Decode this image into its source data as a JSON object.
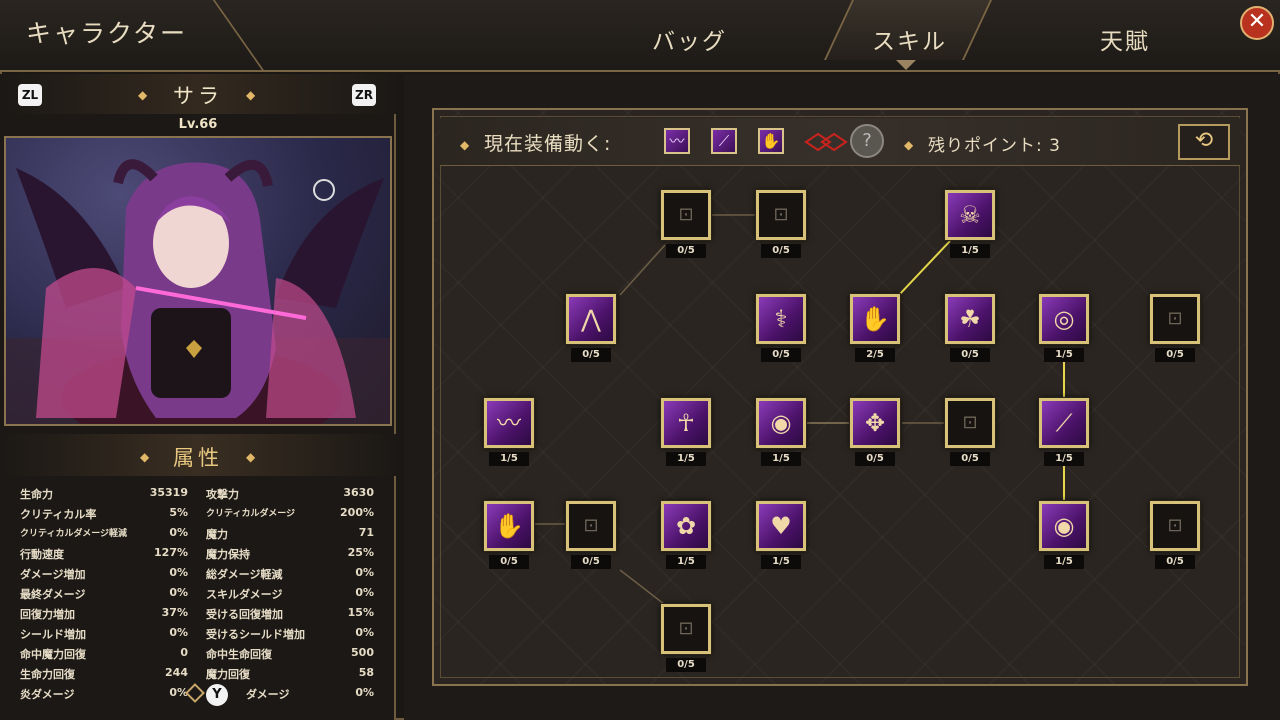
{
  "header": {
    "title": "キャラクター",
    "tabs": [
      {
        "label": "バッグ",
        "active": false
      },
      {
        "label": "スキル",
        "active": true
      },
      {
        "label": "天賦",
        "active": false
      }
    ],
    "close_icon": "close-icon"
  },
  "character": {
    "zl": "ZL",
    "zr": "ZR",
    "name": "サラ",
    "level": "Lv.66"
  },
  "attributes": {
    "title": "属性",
    "left": [
      {
        "label": "生命力",
        "value": "35319"
      },
      {
        "label": "クリティカル率",
        "value": "5%"
      },
      {
        "label": "クリティカルダメージ軽減",
        "value": "0%"
      },
      {
        "label": "行動速度",
        "value": "127%"
      },
      {
        "label": "ダメージ増加",
        "value": "0%"
      },
      {
        "label": "最終ダメージ",
        "value": "0%"
      },
      {
        "label": "回復力増加",
        "value": "37%"
      },
      {
        "label": "シールド増加",
        "value": "0%"
      },
      {
        "label": "命中魔力回復",
        "value": "0"
      },
      {
        "label": "生命力回復",
        "value": "244"
      },
      {
        "label": "炎ダメージ",
        "value": "0%"
      }
    ],
    "right": [
      {
        "label": "攻撃力",
        "value": "3630"
      },
      {
        "label": "クリティカルダメージ",
        "value": "200%"
      },
      {
        "label": "魔力",
        "value": "71"
      },
      {
        "label": "魔力保持",
        "value": "25%"
      },
      {
        "label": "総ダメージ軽減",
        "value": "0%"
      },
      {
        "label": "スキルダメージ",
        "value": "0%"
      },
      {
        "label": "受ける回復増加",
        "value": "15%"
      },
      {
        "label": "受けるシールド増加",
        "value": "0%"
      },
      {
        "label": "命中生命回復",
        "value": "500"
      },
      {
        "label": "魔力回復",
        "value": "58"
      },
      {
        "label": "ダメージ",
        "value": "0%"
      }
    ]
  },
  "skills_panel": {
    "equipped_label": "現在装備動く:",
    "remaining_label": "残りポイント: 3",
    "help": "?",
    "reset_icon": "reset-icon",
    "y_button": "Y"
  },
  "skill_nodes": [
    {
      "id": "n1",
      "icon": "lock-icon",
      "glyph": "🔒",
      "state": "locked",
      "level": "0/5"
    },
    {
      "id": "n2",
      "icon": "lock-icon",
      "glyph": "🔒",
      "state": "locked",
      "level": "0/5"
    },
    {
      "id": "n3",
      "icon": "skull-icon",
      "glyph": "☠",
      "state": "active",
      "level": "1/5"
    },
    {
      "id": "n4",
      "icon": "bat-icon",
      "glyph": "🦇",
      "state": "active",
      "level": "0/5"
    },
    {
      "id": "n5",
      "icon": "staff-icon",
      "glyph": "⚕",
      "state": "active",
      "level": "0/5"
    },
    {
      "id": "n6",
      "icon": "hand-icon",
      "glyph": "✋",
      "state": "active",
      "level": "2/5"
    },
    {
      "id": "n7",
      "icon": "triquetra-icon",
      "glyph": "☘",
      "state": "active",
      "level": "0/5"
    },
    {
      "id": "n8",
      "icon": "swirl-orb-icon",
      "glyph": "◎",
      "state": "active",
      "level": "1/5"
    },
    {
      "id": "n9",
      "icon": "lock-icon",
      "glyph": "🔒",
      "state": "locked",
      "level": "0/5"
    },
    {
      "id": "n10",
      "icon": "whip-icon",
      "glyph": "〰",
      "state": "active",
      "level": "1/5"
    },
    {
      "id": "n11",
      "icon": "ankh-icon",
      "glyph": "☥",
      "state": "active",
      "level": "1/5"
    },
    {
      "id": "n12",
      "icon": "vortex-icon",
      "glyph": "🌀",
      "state": "active",
      "level": "1/5"
    },
    {
      "id": "n13",
      "icon": "voodoo-doll-icon",
      "glyph": "✥",
      "state": "active",
      "level": "0/5"
    },
    {
      "id": "n14",
      "icon": "lock-icon",
      "glyph": "🔒",
      "state": "locked",
      "level": "0/5"
    },
    {
      "id": "n15",
      "icon": "slash-icon",
      "glyph": "⟋",
      "state": "active",
      "level": "1/5"
    },
    {
      "id": "n16",
      "icon": "claw-hand-icon",
      "glyph": "✋",
      "state": "active",
      "level": "0/5"
    },
    {
      "id": "n17",
      "icon": "lock-icon",
      "glyph": "🔒",
      "state": "locked",
      "level": "0/5"
    },
    {
      "id": "n18",
      "icon": "flower-icon",
      "glyph": "✿",
      "state": "active",
      "level": "1/5"
    },
    {
      "id": "n19",
      "icon": "heart-armor-icon",
      "glyph": "♥",
      "state": "active",
      "level": "1/5"
    },
    {
      "id": "n20",
      "icon": "eye-icon",
      "glyph": "◉",
      "state": "active",
      "level": "1/5"
    },
    {
      "id": "n21",
      "icon": "lock-icon",
      "glyph": "🔒",
      "state": "locked",
      "level": "0/5"
    },
    {
      "id": "n22",
      "icon": "lock-icon",
      "glyph": "🔒",
      "state": "locked",
      "level": "0/5"
    }
  ]
}
